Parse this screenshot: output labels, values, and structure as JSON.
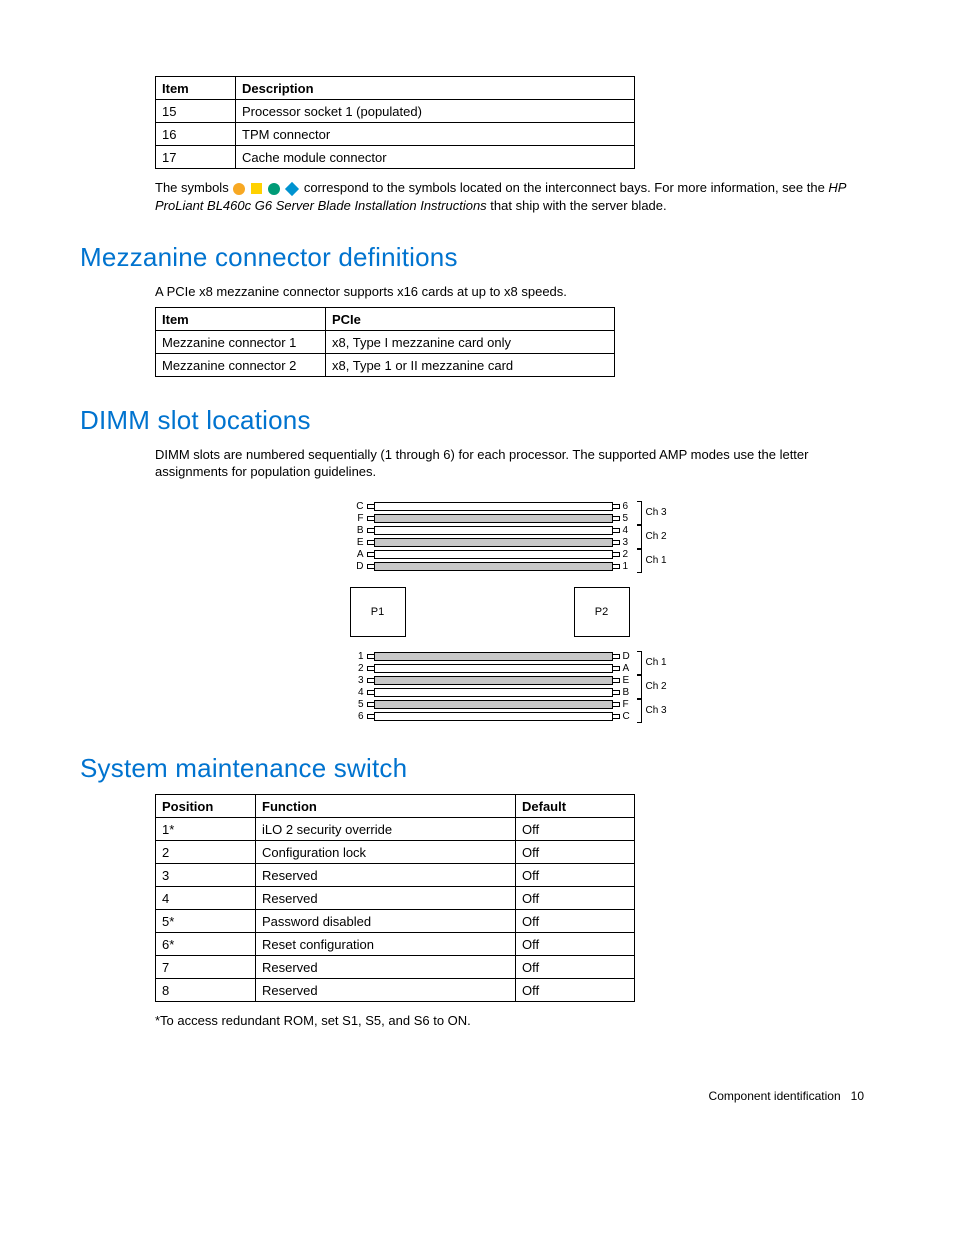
{
  "table1": {
    "headers": [
      "Item",
      "Description"
    ],
    "rows": [
      [
        "15",
        "Processor socket 1 (populated)"
      ],
      [
        "16",
        "TPM connector"
      ],
      [
        "17",
        "Cache module connector"
      ]
    ]
  },
  "symbols_note_a": "The symbols ",
  "symbols_note_b": " correspond to the symbols located on the interconnect bays. For more information, see the ",
  "symbols_note_italic": "HP ProLiant BL460c G6 Server Blade Installation Instructions",
  "symbols_note_c": " that ship with the server blade.",
  "heading_mezz": "Mezzanine connector definitions",
  "mezz_text": "A PCIe x8 mezzanine connector supports x16 cards at up to x8 speeds.",
  "table2": {
    "headers": [
      "Item",
      "PCIe"
    ],
    "rows": [
      [
        "Mezzanine connector 1",
        "x8, Type I mezzanine card only"
      ],
      [
        "Mezzanine connector 2",
        "x8, Type 1 or II mezzanine card"
      ]
    ]
  },
  "heading_dimm": "DIMM slot locations",
  "dimm_text": "DIMM slots are numbered sequentially (1 through 6) for each processor. The supported AMP modes use the letter assignments for population guidelines.",
  "dimm_diagram": {
    "top_left_labels": [
      "C",
      "F",
      "B",
      "E",
      "A",
      "D"
    ],
    "top_right_labels": [
      "6",
      "5",
      "4",
      "3",
      "2",
      "1"
    ],
    "top_channels": [
      "Ch 3",
      "Ch 2",
      "Ch 1"
    ],
    "proc": [
      "P1",
      "P2"
    ],
    "bot_left_labels": [
      "1",
      "2",
      "3",
      "4",
      "5",
      "6"
    ],
    "bot_right_labels": [
      "D",
      "A",
      "E",
      "B",
      "F",
      "C"
    ],
    "bot_channels": [
      "Ch 1",
      "Ch 2",
      "Ch 3"
    ]
  },
  "heading_sys": "System maintenance switch",
  "table3": {
    "headers": [
      "Position",
      "Function",
      "Default"
    ],
    "rows": [
      [
        "1*",
        "iLO 2 security override",
        "Off"
      ],
      [
        "2",
        "Configuration lock",
        "Off"
      ],
      [
        "3",
        "Reserved",
        "Off"
      ],
      [
        "4",
        "Reserved",
        "Off"
      ],
      [
        "5*",
        "Password disabled",
        "Off"
      ],
      [
        "6*",
        "Reset configuration",
        "Off"
      ],
      [
        "7",
        "Reserved",
        "Off"
      ],
      [
        "8",
        "Reserved",
        "Off"
      ]
    ]
  },
  "sys_footnote": "*To access redundant ROM, set S1, S5, and S6 to ON.",
  "footer_section": "Component identification",
  "footer_page": "10"
}
